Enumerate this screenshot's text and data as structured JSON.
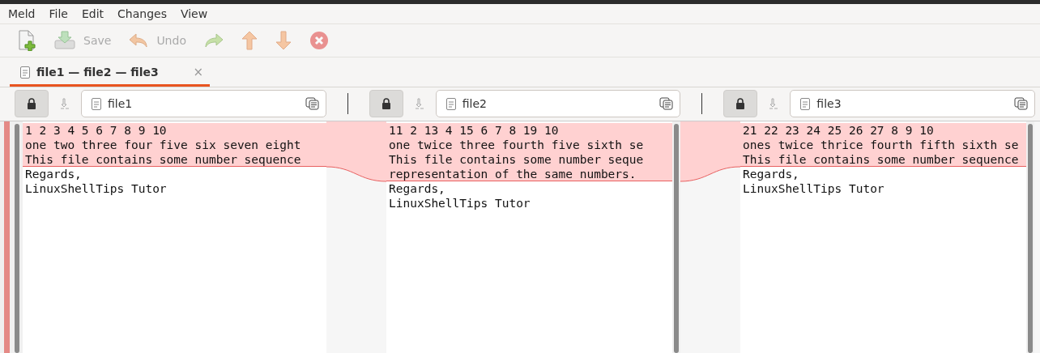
{
  "menu": [
    "Meld",
    "File",
    "Edit",
    "Changes",
    "View"
  ],
  "toolbar": [
    {
      "kind": "new",
      "disabled": false
    },
    {
      "kind": "save",
      "label": "Save",
      "disabled": true
    },
    {
      "kind": "undo",
      "label": "Undo",
      "disabled": true
    },
    {
      "kind": "redo",
      "disabled": true
    },
    {
      "kind": "up",
      "disabled": true
    },
    {
      "kind": "down",
      "disabled": true
    },
    {
      "kind": "stop",
      "disabled": true
    }
  ],
  "tabs": [
    {
      "label": "file1 — file2 — file3",
      "close": "×",
      "selected": true
    }
  ],
  "panes": [
    {
      "file": "file1",
      "locked": true,
      "lines": [
        {
          "text": "1 2 3 4 5 6 7 8 9 10",
          "changed": true
        },
        {
          "text": "one two three four five six seven eight",
          "changed": true
        },
        {
          "text": "This file contains some number sequence",
          "changed": true
        },
        {
          "text": "Regards,",
          "changed": false
        },
        {
          "text": "LinuxShellTips Tutor",
          "changed": false
        }
      ]
    },
    {
      "file": "file2",
      "locked": true,
      "lines": [
        {
          "text": "11 2 13 4 15 6 7 8 19 10",
          "changed": true
        },
        {
          "text": "one twice three fourth five sixth se",
          "changed": true
        },
        {
          "text": "This file contains some number seque",
          "changed": true
        },
        {
          "text": "representation of the same numbers.",
          "changed": true
        },
        {
          "text": "Regards,",
          "changed": false
        },
        {
          "text": "LinuxShellTips Tutor",
          "changed": false
        }
      ]
    },
    {
      "file": "file3",
      "locked": true,
      "lines": [
        {
          "text": "21 22 23 24 25 26 27 8 9 10",
          "changed": true
        },
        {
          "text": "ones twice thrice fourth fifth sixth se",
          "changed": true
        },
        {
          "text": "This file contains some number sequence",
          "changed": true
        },
        {
          "text": "Regards,",
          "changed": false
        },
        {
          "text": "LinuxShellTips Tutor",
          "changed": false
        }
      ]
    }
  ]
}
